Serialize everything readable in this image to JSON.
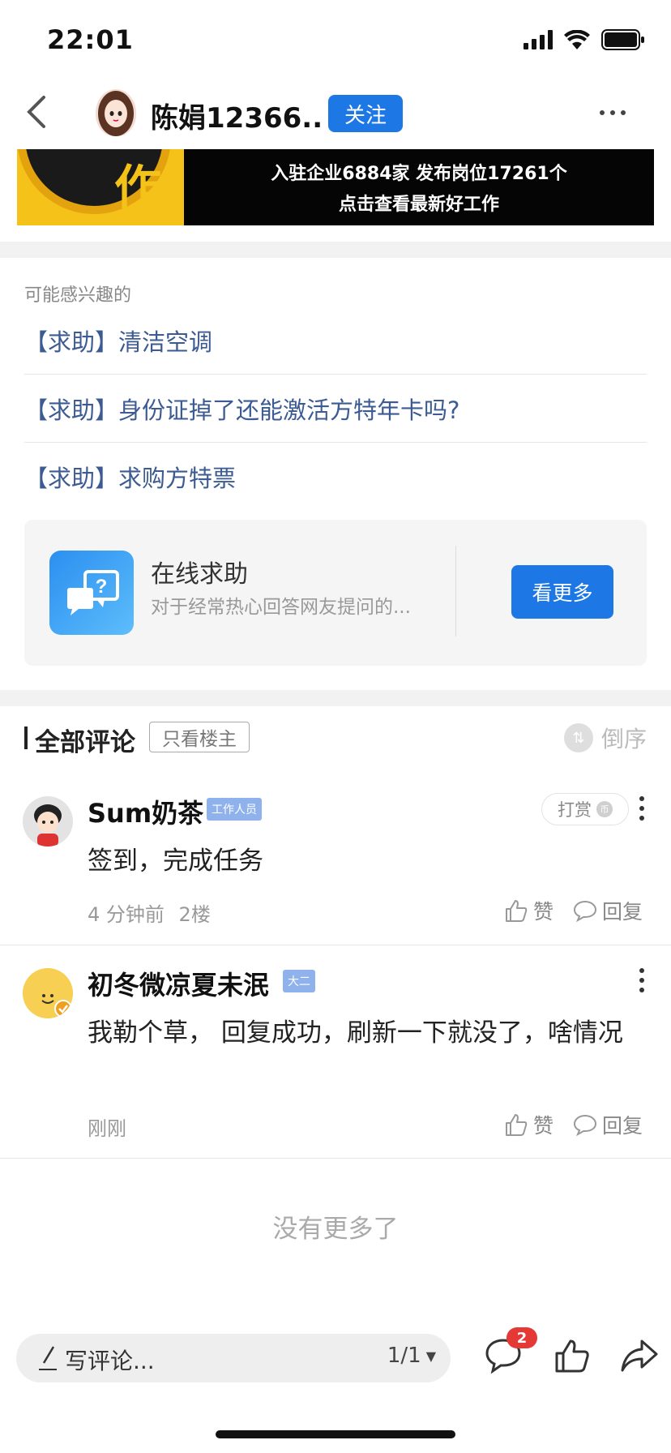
{
  "status_bar": {
    "time": "22:01"
  },
  "nav": {
    "title": "陈娟12366...",
    "follow_label": "关注"
  },
  "banner": {
    "line1": "入驻企业6884家  发布岗位17261个",
    "line2": "点击查看最新好工作",
    "logo_char": "作",
    "colors": {
      "yellow": "#f5c21a",
      "black": "#050505"
    }
  },
  "related": {
    "label": "可能感兴趣的",
    "items": [
      "【求助】清洁空调",
      "【求助】身份证掉了还能激活方特年卡吗?",
      "【求助】求购方特票"
    ]
  },
  "help_card": {
    "title": "在线求助",
    "subtitle": "对于经常热心回答网友提问的...",
    "button": "看更多",
    "icon": "question-bubble-icon"
  },
  "comments_header": {
    "title": "全部评论",
    "filter": "只看楼主",
    "order": "倒序"
  },
  "comments": [
    {
      "name": "Sum奶茶",
      "badge": "工作人员",
      "tip_label": "打赏",
      "text": "签到，完成任务",
      "time": "4 分钟前",
      "floor": "2楼",
      "like": "赞",
      "reply": "回复"
    },
    {
      "name": "初冬微凉夏未泯",
      "badge": "大二",
      "text": "我勒个草， 回复成功，刷新一下就没了，啥情况",
      "time": "刚刚",
      "like": "赞",
      "reply": "回复"
    }
  ],
  "no_more": "没有更多了",
  "bottom_bar": {
    "compose_placeholder": "写评论...",
    "page_indicator": "1/1",
    "message_count": "2"
  },
  "colors": {
    "accent": "#1d78e6",
    "link": "#3b5b92",
    "badge": "#8fb2ec",
    "alert": "#e53935"
  }
}
